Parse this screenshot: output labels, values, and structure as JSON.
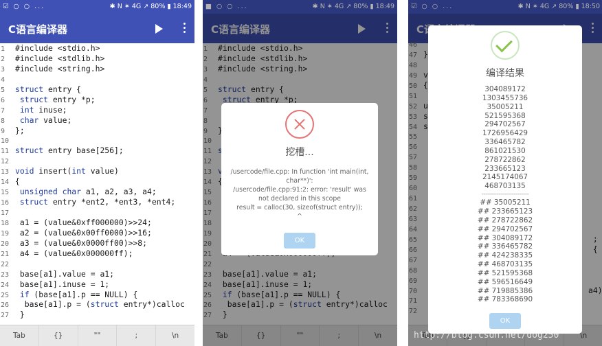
{
  "app": {
    "title": "C语言编译器",
    "status_icons_left": "☑ ○ ○ ...",
    "status_icons_left_alt": "■ ○ ○ ...",
    "status_right_1": "✱ N ✶ 4G ↗ 80% ▮ 18:49",
    "status_right_2": "✱ N ✶ 4G ↗ 80% ▮ 18:49",
    "status_right_3": "✱ N ✶ 4G ↗ 80% ▮ 18:50",
    "run_icon": "play-icon",
    "menu_icon": "more-vert-icon"
  },
  "code_lines": [
    {
      "n": "1",
      "t": "#include <stdio.h>"
    },
    {
      "n": "2",
      "t": "#include <stdlib.h>"
    },
    {
      "n": "3",
      "t": "#include <string.h>"
    },
    {
      "n": "4",
      "t": ""
    },
    {
      "n": "5",
      "t": "struct entry {"
    },
    {
      "n": "6",
      "t": " struct entry *p;"
    },
    {
      "n": "7",
      "t": " int inuse;"
    },
    {
      "n": "8",
      "t": " char value;"
    },
    {
      "n": "9",
      "t": "};"
    },
    {
      "n": "10",
      "t": ""
    },
    {
      "n": "11",
      "t": "struct entry base[256];"
    },
    {
      "n": "12",
      "t": ""
    },
    {
      "n": "13",
      "t": "void insert(int value)"
    },
    {
      "n": "14",
      "t": "{"
    },
    {
      "n": "15",
      "t": " unsigned char a1, a2, a3, a4;"
    },
    {
      "n": "16",
      "t": " struct entry *ent2, *ent3, *ent4;"
    },
    {
      "n": "17",
      "t": ""
    },
    {
      "n": "18",
      "t": " a1 = (value&0xff000000)>>24;"
    },
    {
      "n": "19",
      "t": " a2 = (value&0x00ff0000)>>16;"
    },
    {
      "n": "20",
      "t": " a3 = (value&0x0000ff00)>>8;"
    },
    {
      "n": "21",
      "t": " a4 = (value&0x000000ff);"
    },
    {
      "n": "22",
      "t": ""
    },
    {
      "n": "23",
      "t": " base[a1].value = a1;"
    },
    {
      "n": "24",
      "t": " base[a1].inuse = 1;"
    },
    {
      "n": "25",
      "t": " if (base[a1].p == NULL) {"
    },
    {
      "n": "26",
      "t": "  base[a1].p = (struct entry*)calloc"
    },
    {
      "n": "27",
      "t": " }"
    }
  ],
  "code_lines_3": [
    {
      "n": "46",
      "t": "  {"
    },
    {
      "n": "47",
      "t": "}"
    },
    {
      "n": "48",
      "t": ""
    },
    {
      "n": "49",
      "t": "v"
    },
    {
      "n": "50",
      "t": "{"
    },
    {
      "n": "51",
      "t": ""
    },
    {
      "n": "52",
      "t": "u"
    },
    {
      "n": "53",
      "t": "s"
    },
    {
      "n": "54",
      "t": "s"
    },
    {
      "n": "55",
      "t": ""
    },
    {
      "n": "56",
      "t": ""
    },
    {
      "n": "57",
      "t": ""
    },
    {
      "n": "58",
      "t": ""
    },
    {
      "n": "59",
      "t": ""
    },
    {
      "n": "60",
      "t": ""
    },
    {
      "n": "61",
      "t": ""
    },
    {
      "n": "62",
      "t": ""
    },
    {
      "n": "63",
      "t": ""
    },
    {
      "n": "64",
      "t": ""
    },
    {
      "n": "65",
      "t": "                                    ;"
    },
    {
      "n": "66",
      "t": "                                    {"
    },
    {
      "n": "67",
      "t": ""
    },
    {
      "n": "68",
      "t": ""
    },
    {
      "n": "69",
      "t": ""
    },
    {
      "n": "70",
      "t": "                                   a4)"
    },
    {
      "n": "71",
      "t": ""
    },
    {
      "n": "72",
      "t": ""
    }
  ],
  "keys": [
    "Tab",
    "{}",
    "\"\"",
    ";",
    "\\n"
  ],
  "error_dialog": {
    "icon": "error-x-icon",
    "title": "挖槽...",
    "message_1": "/usercode/file.cpp: In function 'int main(int,",
    "message_2": "char**)':",
    "message_3": "/usercode/file.cpp:91:2: error: 'result' was",
    "message_4": "not declared in this scope",
    "message_5": "result = calloc(30, sizeof(struct entry));",
    "message_6": "^",
    "ok": "OK"
  },
  "result_dialog": {
    "icon": "success-check-icon",
    "title": "编译结果",
    "values": [
      "304089172",
      "1303455736",
      "35005211",
      "521595368",
      "294702567",
      "1726956429",
      "336465782",
      "861021530",
      "278722862",
      "233665123",
      "2145174067",
      "468703135"
    ],
    "separator": "-------------------------",
    "sorted": [
      "## 35005211",
      "## 233665123",
      "## 278722862",
      "## 294702567",
      "## 304089172",
      "## 336465782",
      "## 424238335",
      "## 468703135",
      "## 521595368",
      "## 596516649",
      "## 719885386",
      "## 783368690"
    ],
    "ok": "OK"
  },
  "watermark": "http://blog.csdn.net/dog250"
}
